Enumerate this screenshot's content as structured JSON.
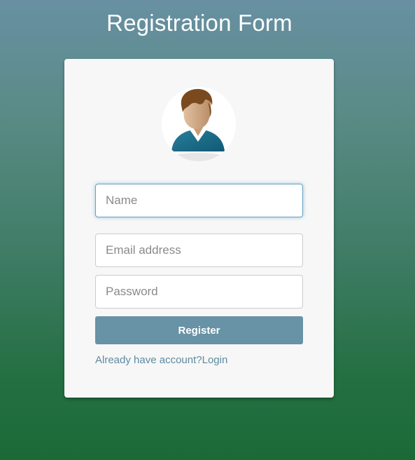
{
  "page": {
    "title": "Registration Form"
  },
  "form": {
    "name_placeholder": "Name",
    "email_placeholder": "Email address",
    "password_placeholder": "Password",
    "register_label": "Register",
    "login_prompt": "Already have account?",
    "login_label": "Login"
  },
  "avatar": {
    "icon": "user-avatar-icon"
  },
  "colors": {
    "button": "#6892a5",
    "link": "#5d8ba0",
    "card": "#f7f7f7",
    "focus_border": "#66a1c6",
    "bg_top": "#6890a2",
    "bg_bottom": "#1a6a36"
  }
}
